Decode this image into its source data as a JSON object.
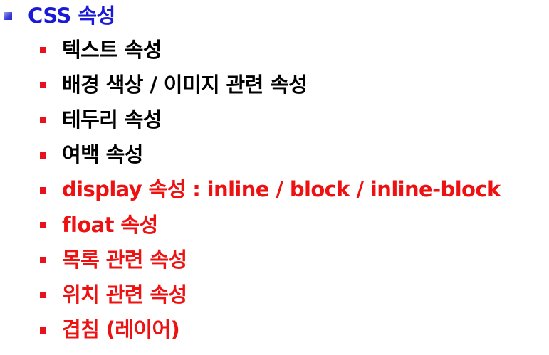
{
  "heading": {
    "text": "CSS 속성",
    "color": "#1a1ad6"
  },
  "colors": {
    "bullet": "#e8121a",
    "normal_text": "#000000",
    "highlight_text": "#ee1111"
  },
  "items": [
    {
      "text": "텍스트 속성",
      "highlight": false
    },
    {
      "text": "배경 색상 / 이미지 관련 속성",
      "highlight": false
    },
    {
      "text": "테두리 속성",
      "highlight": false
    },
    {
      "text": "여백 속성",
      "highlight": false
    },
    {
      "text": "display 속성 : inline / block / inline-block",
      "highlight": true
    },
    {
      "text": "float 속성",
      "highlight": true
    },
    {
      "text": "목록 관련 속성",
      "highlight": true
    },
    {
      "text": "위치 관련 속성",
      "highlight": true
    },
    {
      "text": "겹침 (레이어)",
      "highlight": true
    }
  ]
}
